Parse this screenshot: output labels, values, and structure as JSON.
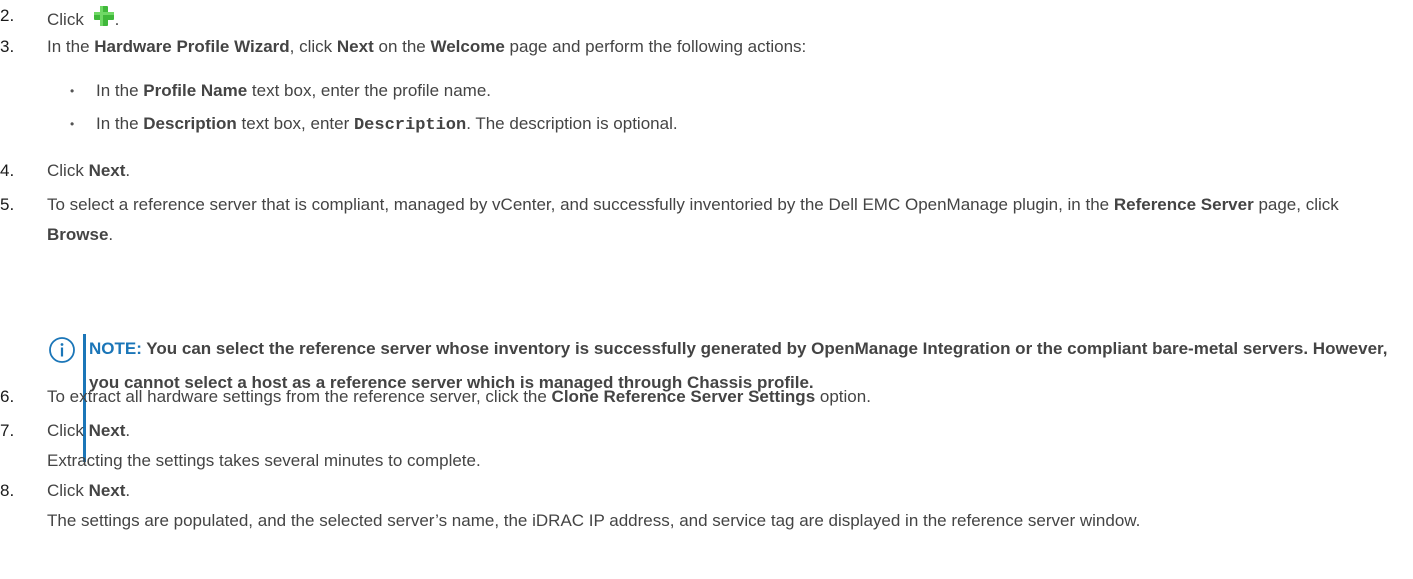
{
  "steps": [
    {
      "num": "2.",
      "pre": "Click ",
      "post": "."
    },
    {
      "num": "3.",
      "t1": "In the ",
      "b1": "Hardware Profile Wizard",
      "t2": ", click ",
      "b2": "Next",
      "t3": " on the ",
      "b3": "Welcome",
      "t4": " page and perform the following actions:"
    },
    {
      "num": "4.",
      "t1": "Click ",
      "b1": "Next",
      "t2": "."
    },
    {
      "num": "5.",
      "t1": "To select a reference server that is compliant, managed by vCenter, and successfully inventoried by the Dell EMC OpenManage plugin, in the ",
      "b1": "Reference Server",
      "t2": " page, click ",
      "b2": "Browse",
      "t3": "."
    },
    {
      "num": "6.",
      "t1": "To extract all hardware settings from the reference server, click the ",
      "b1": "Clone Reference Server Settings",
      "t2": " option."
    },
    {
      "num": "7.",
      "t1": "Click ",
      "b1": "Next",
      "t2": ".",
      "line2": "Extracting the settings takes several minutes to complete."
    },
    {
      "num": "8.",
      "t1": "Click ",
      "b1": "Next",
      "t2": ".",
      "line2": "The settings are populated, and the selected server’s name, the iDRAC IP address, and service tag are displayed in the reference server window."
    }
  ],
  "bullets": [
    {
      "t1": "In the ",
      "b1": "Profile Name",
      "t2": " text box, enter the profile name."
    },
    {
      "t1": "In the ",
      "b1": "Description",
      "t2": " text box, enter ",
      "code": "Description",
      "t3": ". The description is optional."
    }
  ],
  "note": {
    "label": "NOTE:",
    "text": " You can select the reference server whose inventory is successfully generated by OpenManage Integration or the compliant bare-metal servers. However, you cannot select a host as a reference server which is managed through Chassis profile."
  },
  "colors": {
    "note_accent": "#1b76b8",
    "plus_icon": "#3fb83a",
    "text": "#444444"
  },
  "icons": [
    "plus-icon",
    "info-icon"
  ]
}
